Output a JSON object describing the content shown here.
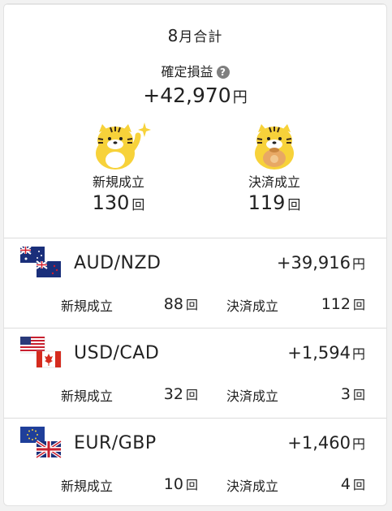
{
  "summary": {
    "month_number": "8",
    "month_suffix": "月合計",
    "pnl_label": "確定損益",
    "help_icon": "?",
    "pnl_value": "+42,970",
    "pnl_unit": "円",
    "new_label": "新規成立",
    "new_count": "130",
    "close_label": "決済成立",
    "close_count": "119",
    "count_unit": "回"
  },
  "pairs": [
    {
      "name": "AUD/NZD",
      "pnl": "+39,916",
      "unit": "円",
      "new_label": "新規成立",
      "new_count": "88",
      "close_label": "決済成立",
      "close_count": "112",
      "count_unit": "回",
      "flags": [
        "australia-flag",
        "new-zealand-flag"
      ]
    },
    {
      "name": "USD/CAD",
      "pnl": "+1,594",
      "unit": "円",
      "new_label": "新規成立",
      "new_count": "32",
      "close_label": "決済成立",
      "close_count": "3",
      "count_unit": "回",
      "flags": [
        "usa-flag",
        "canada-flag"
      ]
    },
    {
      "name": "EUR/GBP",
      "pnl": "+1,460",
      "unit": "円",
      "new_label": "新規成立",
      "new_count": "10",
      "close_label": "決済成立",
      "close_count": "4",
      "count_unit": "回",
      "flags": [
        "eu-flag",
        "uk-flag"
      ]
    }
  ],
  "colors": {
    "mascot_yellow": "#f7d23a",
    "mascot_stripe": "#3a2a1a",
    "divider": "#dcdcdc",
    "help_icon_bg": "#7f7f7f"
  }
}
